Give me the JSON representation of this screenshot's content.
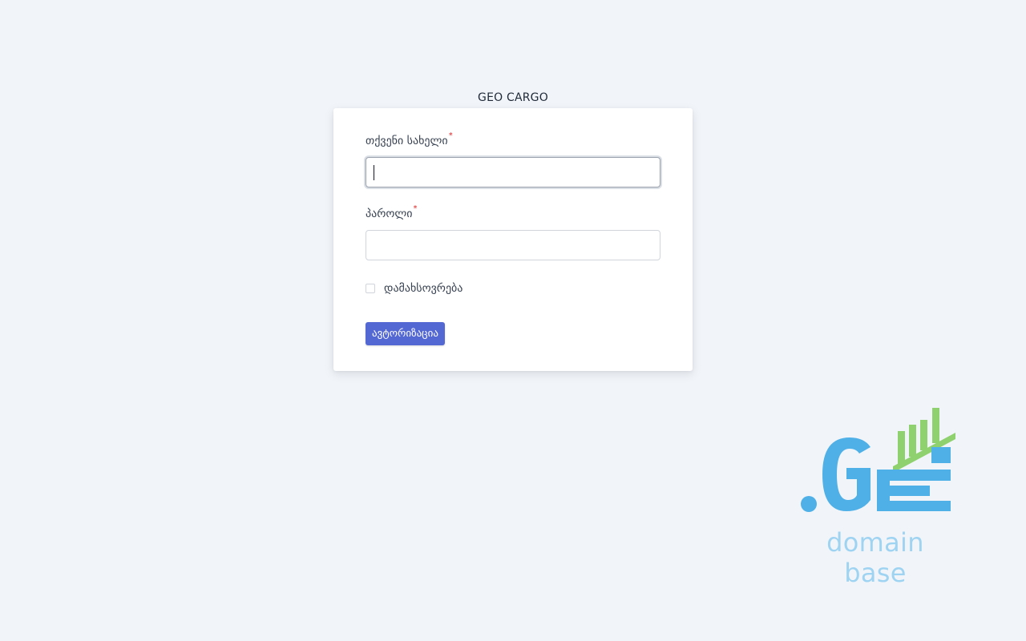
{
  "app": {
    "title": "GEO CARGO"
  },
  "form": {
    "username_label": "თქვენი სახელი",
    "username_required": "*",
    "username_value": "",
    "password_label": "პაროლი",
    "password_required": "*",
    "password_value": "",
    "remember_label": "დამახსოვრება",
    "remember_checked": false,
    "submit_label": "ავტორიზაცია"
  },
  "logo": {
    "tld": ".GE",
    "tagline": "domain base",
    "icon": "bar-chart-icon"
  },
  "colors": {
    "background": "#f1f5f9",
    "primary_button": "#5468d4",
    "required_marker": "#dc2626",
    "logo_blue": "#4fb0e8",
    "logo_green": "#8fd16f",
    "logo_tagline": "#9fd3f2"
  }
}
